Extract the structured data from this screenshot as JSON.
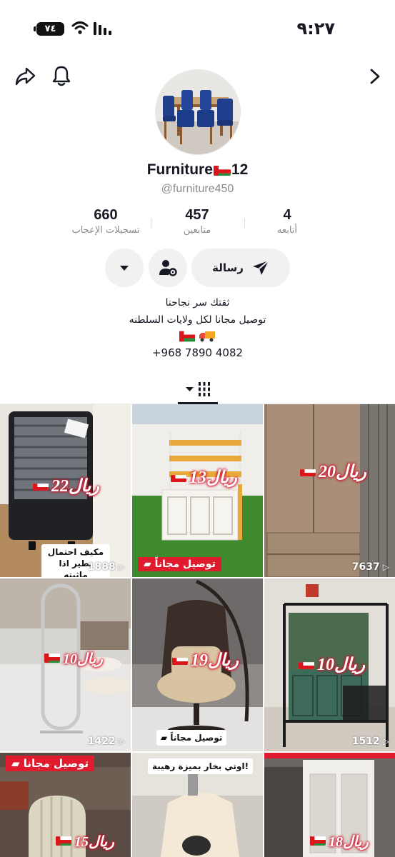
{
  "status_bar": {
    "time": "٩:٢٧",
    "battery": "٧٤"
  },
  "profile": {
    "display_name_prefix": "Furniture",
    "display_name_suffix": "12",
    "username": "@furniture450"
  },
  "stats": {
    "following_count": "4",
    "following_label": "أتابعه",
    "followers_count": "457",
    "followers_label": "متابعين",
    "likes_count": "660",
    "likes_label": "تسجيلات الإعجاب"
  },
  "actions": {
    "message_label": "رسالة"
  },
  "bio": {
    "line1": "ثقتك سر نجاحنا",
    "line2": "توصيل مجانا لكل ولايات السلطنه",
    "phone": "+968 7890 4082"
  },
  "videos": [
    {
      "price": "22ريال",
      "views": "1888",
      "caption": "مكيف احتمال يطير اذا ماثبته"
    },
    {
      "price": "13ريال",
      "caption": "توصيل مجاناً"
    },
    {
      "price": "20ريال",
      "views": "7637"
    },
    {
      "price": "10ريال",
      "views": "1422"
    },
    {
      "price": "19ريال",
      "caption": "توصيل مجاناً"
    },
    {
      "price": "10ريال",
      "views": "1512"
    },
    {
      "price": "15ريال",
      "caption": "توصيل مجانا"
    },
    {
      "caption": "اوتي بخار بميزة رهيبة!"
    },
    {
      "price": "18ريال"
    }
  ],
  "icons": {
    "share": "share-arrow-icon",
    "notifications": "bell-icon",
    "forward": "chevron-right-icon",
    "message": "send-icon",
    "suggested": "user-gear-icon",
    "more": "caret-down-icon",
    "grid_tab": "grid-bars-icon"
  },
  "colors": {
    "accent_red": "#e01b2e",
    "muted_text": "#8a8b91",
    "button_bg": "#f1f1f2"
  }
}
